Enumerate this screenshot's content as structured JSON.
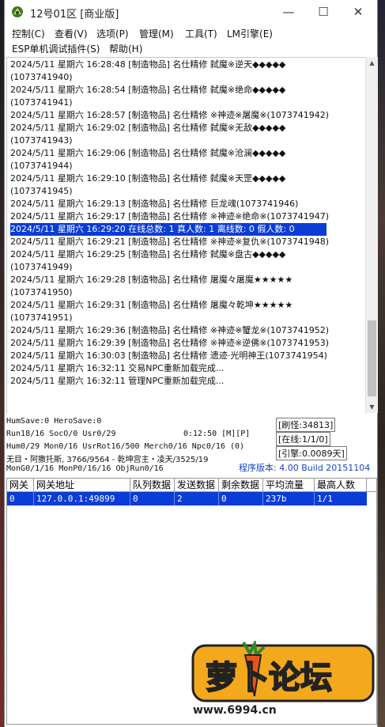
{
  "window": {
    "title": "12号01区 [商业版]"
  },
  "titlebar_buttons": {
    "minimize": "—",
    "maximize": "☐",
    "close": "✕"
  },
  "menu": [
    "控制(C)",
    "查看(V)",
    "选项(P)",
    "管理(M)",
    "工具(T)",
    "LM引擎(E)",
    "ESP单机调试插件(S)",
    "帮助(H)"
  ],
  "log": [
    "2024/5/11 星期六 16:28:48 [制造物品] 名仕精修 弑魔※逆天◆◆◆◆◆",
    "(1073741940)",
    "2024/5/11 星期六 16:28:54 [制造物品] 名仕精修 弑魔※绝命◆◆◆◆◆",
    "(1073741941)",
    "2024/5/11 星期六 16:28:57 [制造物品] 名仕精修 ※神迹※屠魔※(1073741942)",
    "2024/5/11 星期六 16:29:02 [制造物品] 名仕精修 弑魔※无敌◆◆◆◆◆",
    "(1073741943)",
    "2024/5/11 星期六 16:29:06 [制造物品] 名仕精修 弑魔※沧澜◆◆◆◆◆",
    "(1073741944)",
    "2024/5/11 星期六 16:29:10 [制造物品] 名仕精修 弑魔※天罡◆◆◆◆◆",
    "(1073741945)",
    "2024/5/11 星期六 16:29:13 [制造物品] 名仕精修 巨龙魂(1073741946)",
    "2024/5/11 星期六 16:29:17 [制造物品] 名仕精修 ※神迹※绝命※(1073741947)",
    "2024/5/11 星期六 16:29:20 在线总数: 1 真人数: 1 离线数: 0 假人数: 0",
    "2024/5/11 星期六 16:29:21 [制造物品] 名仕精修 ※神迹※复仇※(1073741948)",
    "2024/5/11 星期六 16:29:25 [制造物品] 名仕精修 弑魔※盘古◆◆◆◆◆",
    "(1073741949)",
    "2024/5/11 星期六 16:29:28 [制造物品] 名仕精修 屠魔々屠魔★★★★★",
    "(1073741950)",
    "2024/5/11 星期六 16:29:31 [制造物品] 名仕精修 屠魔々乾坤★★★★★",
    "(1073741951)",
    "2024/5/11 星期六 16:29:36 [制造物品] 名仕精修 ※神迹※蟹龙※(1073741952)",
    "2024/5/11 星期六 16:29:39 [制造物品] 名仕精修 ※神迹※逆佛※(1073741953)",
    "2024/5/11 星期六 16:30:03 [制造物品] 名仕精修 遗迹·光明神王(1073741954)",
    "2024/5/11 星期六 16:32:11 交易NPC重新加载完成...",
    "2024/5/11 星期六 16:32:11 管理NPC重新加载完成..."
  ],
  "status": {
    "line1": "HumSave:0 HeroSave:0",
    "line2a": "Run18/16 SocO/0 Usr0/29",
    "line2b": "0:12:50 [M][P]",
    "line3": "Hum0/29 Mon0/16 UsrRot16/500 Merch0/16 Npc0/16 (0)",
    "line4": "无目・阿撒托斯, 3766/9564 - 乾坤宫主・凌天/3525/19",
    "line5": "MonG0/1/16 MonP0/16/16 ObjRun0/16",
    "box_refresh": "[刷怪:34813]",
    "box_online": "[在线:1/1/0]",
    "box_engine": "[引擎:0.0089天]",
    "version": "程序版本: 4.00 Build 20151104"
  },
  "grid": {
    "headers": [
      "网关",
      "网关地址",
      "队列数据",
      "发送数据",
      "剩余数据",
      "平均流量",
      "最高人数"
    ],
    "rows": [
      [
        "0",
        "127.0.0.1:49899",
        "0",
        "2",
        "0",
        "237b",
        "1/1"
      ]
    ]
  },
  "logo": {
    "text": "萝卜论坛",
    "url": "www.6994.cn"
  }
}
